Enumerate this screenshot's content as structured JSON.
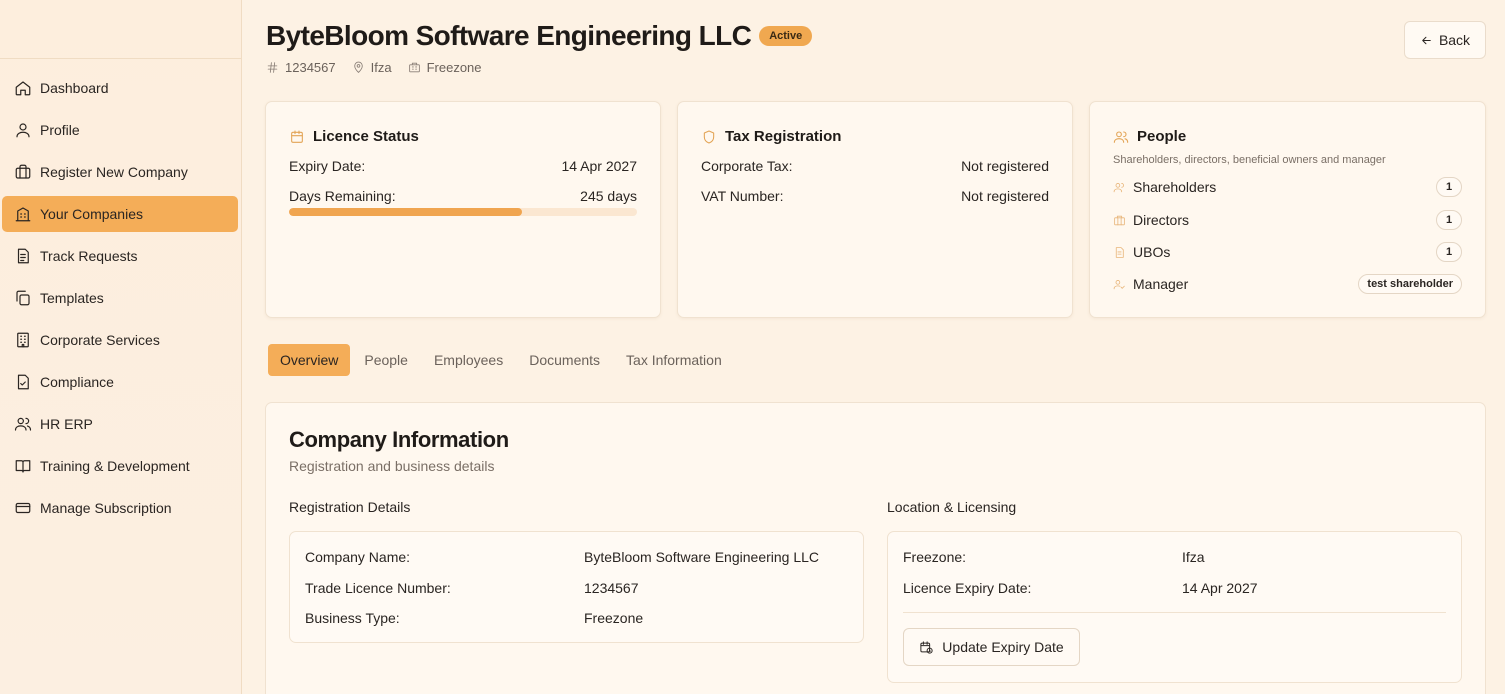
{
  "sidebar": {
    "items": [
      {
        "label": "Dashboard",
        "icon": "home-icon",
        "active": false
      },
      {
        "label": "Profile",
        "icon": "user-icon",
        "active": false
      },
      {
        "label": "Register New Company",
        "icon": "briefcase-icon",
        "active": false
      },
      {
        "label": "Your Companies",
        "icon": "building-icon",
        "active": true
      },
      {
        "label": "Track Requests",
        "icon": "document-icon",
        "active": false
      },
      {
        "label": "Templates",
        "icon": "copy-icon",
        "active": false
      },
      {
        "label": "Corporate Services",
        "icon": "office-icon",
        "active": false
      },
      {
        "label": "Compliance",
        "icon": "file-check-icon",
        "active": false
      },
      {
        "label": "HR ERP",
        "icon": "users-icon",
        "active": false
      },
      {
        "label": "Training & Development",
        "icon": "book-icon",
        "active": false
      },
      {
        "label": "Manage Subscription",
        "icon": "credit-card-icon",
        "active": false
      }
    ]
  },
  "header": {
    "company_name": "ByteBloom Software Engineering LLC",
    "status": "Active",
    "licence_number": "1234567",
    "location": "Ifza",
    "type": "Freezone",
    "back_label": "Back"
  },
  "licence_card": {
    "title": "Licence Status",
    "expiry_label": "Expiry Date:",
    "expiry_value": "14 Apr 2027",
    "remaining_label": "Days Remaining:",
    "remaining_value": "245 days",
    "progress_fraction": 0.67
  },
  "tax_card": {
    "title": "Tax Registration",
    "corporate_label": "Corporate Tax:",
    "corporate_value": "Not registered",
    "vat_label": "VAT Number:",
    "vat_value": "Not registered"
  },
  "people_card": {
    "title": "People",
    "subtitle": "Shareholders, directors, beneficial owners and manager",
    "shareholders_label": "Shareholders",
    "shareholders_count": "1",
    "directors_label": "Directors",
    "directors_count": "1",
    "ubos_label": "UBOs",
    "ubos_count": "1",
    "manager_label": "Manager",
    "manager_value": "test shareholder"
  },
  "tabs": [
    {
      "label": "Overview",
      "active": true
    },
    {
      "label": "People",
      "active": false
    },
    {
      "label": "Employees",
      "active": false
    },
    {
      "label": "Documents",
      "active": false
    },
    {
      "label": "Tax Information",
      "active": false
    }
  ],
  "company_info": {
    "title": "Company Information",
    "subtitle": "Registration and business details",
    "registration": {
      "heading": "Registration Details",
      "name_label": "Company Name:",
      "name_value": "ByteBloom Software Engineering LLC",
      "licence_label": "Trade Licence Number:",
      "licence_value": "1234567",
      "type_label": "Business Type:",
      "type_value": "Freezone"
    },
    "location": {
      "heading": "Location & Licensing",
      "freezone_label": "Freezone:",
      "freezone_value": "Ifza",
      "expiry_label": "Licence Expiry Date:",
      "expiry_value": "14 Apr 2027",
      "update_button": "Update Expiry Date"
    }
  },
  "colors": {
    "accent": "#f4ad58",
    "background": "#fdf2e4",
    "card": "#fff8ef"
  }
}
